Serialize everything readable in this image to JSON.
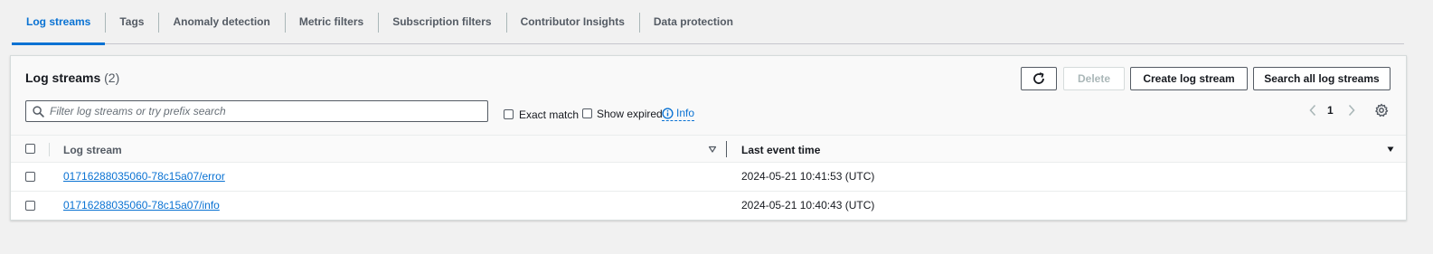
{
  "tabs": [
    {
      "label": "Log streams",
      "active": true
    },
    {
      "label": "Tags"
    },
    {
      "label": "Anomaly detection"
    },
    {
      "label": "Metric filters"
    },
    {
      "label": "Subscription filters"
    },
    {
      "label": "Contributor Insights"
    },
    {
      "label": "Data protection"
    }
  ],
  "panel": {
    "title": "Log streams",
    "count": "(2)",
    "buttons": {
      "refresh_icon": "refresh-icon",
      "delete": "Delete",
      "create": "Create log stream",
      "search_all": "Search all log streams"
    },
    "search_placeholder": "Filter log streams or try prefix search",
    "exact_match": "Exact match",
    "show_expired": "Show expired",
    "info": "Info",
    "page": "1"
  },
  "table": {
    "columns": [
      "Log stream",
      "Last event time"
    ],
    "rows": [
      {
        "stream": "01716288035060-78c15a07/error",
        "time": "2024-05-21 10:41:53 (UTC)"
      },
      {
        "stream": "01716288035060-78c15a07/info",
        "time": "2024-05-21 10:40:43 (UTC)"
      }
    ]
  },
  "colors": {
    "accent": "#0972d3",
    "text": "#16191f",
    "muted": "#545b64"
  }
}
